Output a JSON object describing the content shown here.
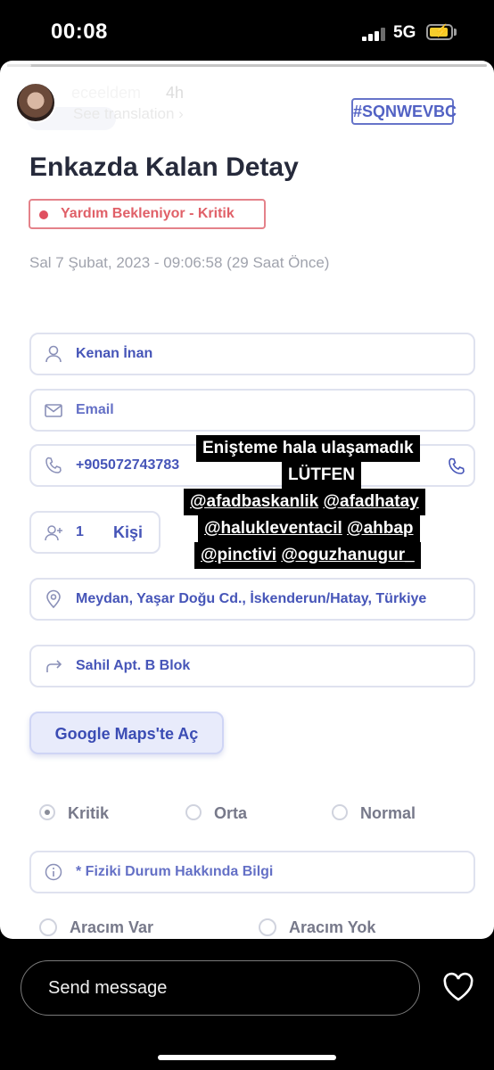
{
  "status_bar": {
    "time": "00:08",
    "network": "5G"
  },
  "story": {
    "progress": 0.05,
    "username": "eceeldem",
    "age": "4h",
    "see_translation": "See translation ›"
  },
  "page": {
    "ticket_id": "#SQNWEVBC",
    "title": "Enkazda Kalan Detay",
    "status_badge": "Yardım Bekleniyor - Kritik",
    "datetime": "Sal 7 Şubat, 2023 - 09:06:58 (29 Saat Önce)",
    "fields": {
      "name": "Kenan İnan",
      "email": "Email",
      "phone": "+905072743783",
      "person_count": "1",
      "person_unit": "Kişi",
      "address": "Meydan, Yaşar Doğu Cd., İskenderun/Hatay, Türkiye",
      "building": "Sahil Apt. B Blok"
    },
    "maps_button": "Google Maps'te Aç",
    "severity_options": [
      "Kritik",
      "Orta",
      "Normal"
    ],
    "selected_severity": "Kritik",
    "info_placeholder": "* Fiziki Durum Hakkında Bilgi",
    "vehicle_options": [
      "Aracım Var",
      "Aracım Yok"
    ]
  },
  "overlay_text": {
    "line1": "Enişteme hala ulaşamadık",
    "line2": "LÜTFEN",
    "line3a": "@afadbaskanlik",
    "line3b": "@afadhatay",
    "line4a": "@halukleventacil",
    "line4b": "@ahbap",
    "line5a": "@pinctivi",
    "line5b": "@oguzhanugur_"
  },
  "reply_bar": {
    "placeholder": "Send message"
  },
  "colors": {
    "accent": "#4655b8",
    "critical": "#e05060",
    "battery": "#f5cd2c"
  }
}
